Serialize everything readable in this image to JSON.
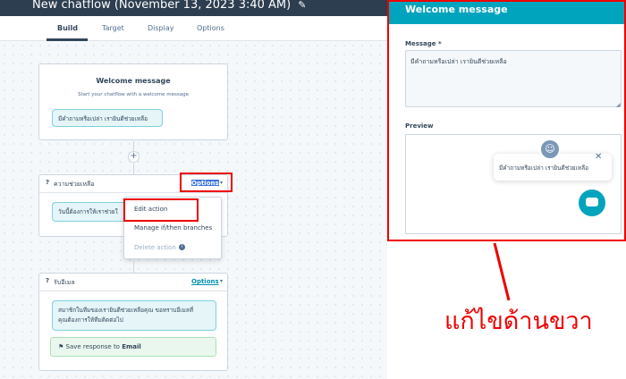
{
  "header": {
    "title": "New chatflow (November 13, 2023 3:40 AM)",
    "edit_icon": "pencil-icon"
  },
  "tabs": [
    {
      "label": "Build"
    },
    {
      "label": "Target"
    },
    {
      "label": "Display"
    },
    {
      "label": "Options"
    }
  ],
  "welcome_card": {
    "title": "Welcome message",
    "subtitle": "Start your chatflow with a welcome message",
    "bubble": "มีคำถามหรือเปล่า เรายินดีช่วยเหลือ"
  },
  "action1": {
    "q": "?",
    "title": "ความช่วยเหลือ",
    "options_label": "Options",
    "bubble": "วันนี้ต้องการให้เราช่วยใ"
  },
  "menu": {
    "items": [
      {
        "label": "Edit action"
      },
      {
        "label": "Manage if/then branches"
      },
      {
        "label": "Delete action"
      }
    ]
  },
  "action2": {
    "q": "?",
    "title": "รับอีเมล",
    "options_label": "Options",
    "bubble_line1": "สมาชิกในทีมของเรายินดีช่วยเหลือคุณ ขอทราบอีเมลที่",
    "bubble_line2": "คุณต้องการให้ทีมติดต่อไป",
    "save_prefix": "Save response to",
    "save_field": "Email"
  },
  "panel": {
    "title": "Welcome message",
    "message_label": "Message *",
    "message_value": "มีคำถามหรือเปล่า เรายินดีช่วยเหลือ",
    "preview_label": "Preview",
    "preview_message": "มีคำถามหรือเปล่า เรายินดีช่วยเหลือ"
  },
  "annotation": "แก้ไขด้านขวา",
  "colors": {
    "accent": "#00a4bd",
    "highlight": "#ee0000",
    "dark": "#2d3e50"
  }
}
